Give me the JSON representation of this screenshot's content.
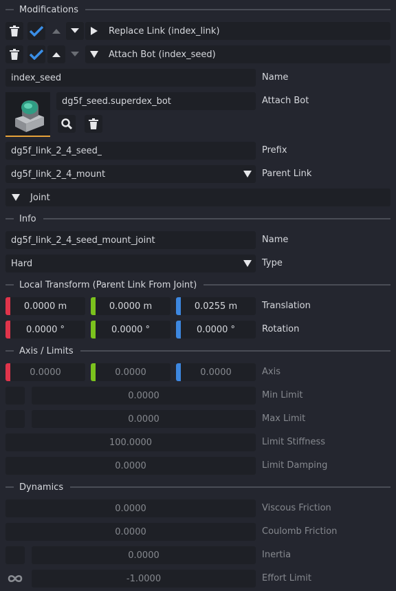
{
  "sections": {
    "modifications": "Modifications",
    "info": "Info",
    "local_transform": "Local Transform (Parent Link From Joint)",
    "axis_limits": "Axis / Limits",
    "dynamics": "Dynamics"
  },
  "modifications": [
    {
      "label": "Replace Link (index_link)",
      "expanded": false
    },
    {
      "label": "Attach Bot (index_seed)",
      "expanded": true
    }
  ],
  "attach": {
    "name_value": "index_seed",
    "name_label": "Name",
    "bot_value": "dg5f_seed.superdex_bot",
    "bot_label": "Attach Bot",
    "prefix_value": "dg5f_link_2_4_seed_",
    "prefix_label": "Prefix",
    "parent_value": "dg5f_link_2_4_mount",
    "parent_label": "Parent Link",
    "joint_header": "Joint"
  },
  "info": {
    "name_value": "dg5f_link_2_4_seed_mount_joint",
    "name_label": "Name",
    "type_value": "Hard",
    "type_label": "Type"
  },
  "transform": {
    "translation": [
      "0.0000 m",
      "0.0000 m",
      "0.0255 m"
    ],
    "translation_label": "Translation",
    "rotation": [
      "0.0000 °",
      "0.0000 °",
      "0.0000 °"
    ],
    "rotation_label": "Rotation"
  },
  "axis": {
    "values": [
      "0.0000",
      "0.0000",
      "0.0000"
    ],
    "axis_label": "Axis",
    "min_limit": "0.0000",
    "min_label": "Min Limit",
    "max_limit": "0.0000",
    "max_label": "Max Limit",
    "stiffness": "100.0000",
    "stiffness_label": "Limit Stiffness",
    "damping": "0.0000",
    "damping_label": "Limit Damping"
  },
  "dynamics": {
    "viscous": "0.0000",
    "viscous_label": "Viscous Friction",
    "coulomb": "0.0000",
    "coulomb_label": "Coulomb Friction",
    "inertia": "0.0000",
    "inertia_label": "Inertia",
    "effort": "-1.0000",
    "effort_label": "Effort Limit"
  },
  "colors": {
    "x_axis": "#e0344b",
    "y_axis": "#7bc21d",
    "z_axis": "#3d87e0",
    "check": "#3a8ee6",
    "thumb_underline": "#e8a33a"
  },
  "icons": [
    "trash-icon",
    "check-icon",
    "arrow-up-icon",
    "arrow-down-icon",
    "triangle-right-icon",
    "triangle-down-icon",
    "search-icon",
    "infinity-icon"
  ]
}
